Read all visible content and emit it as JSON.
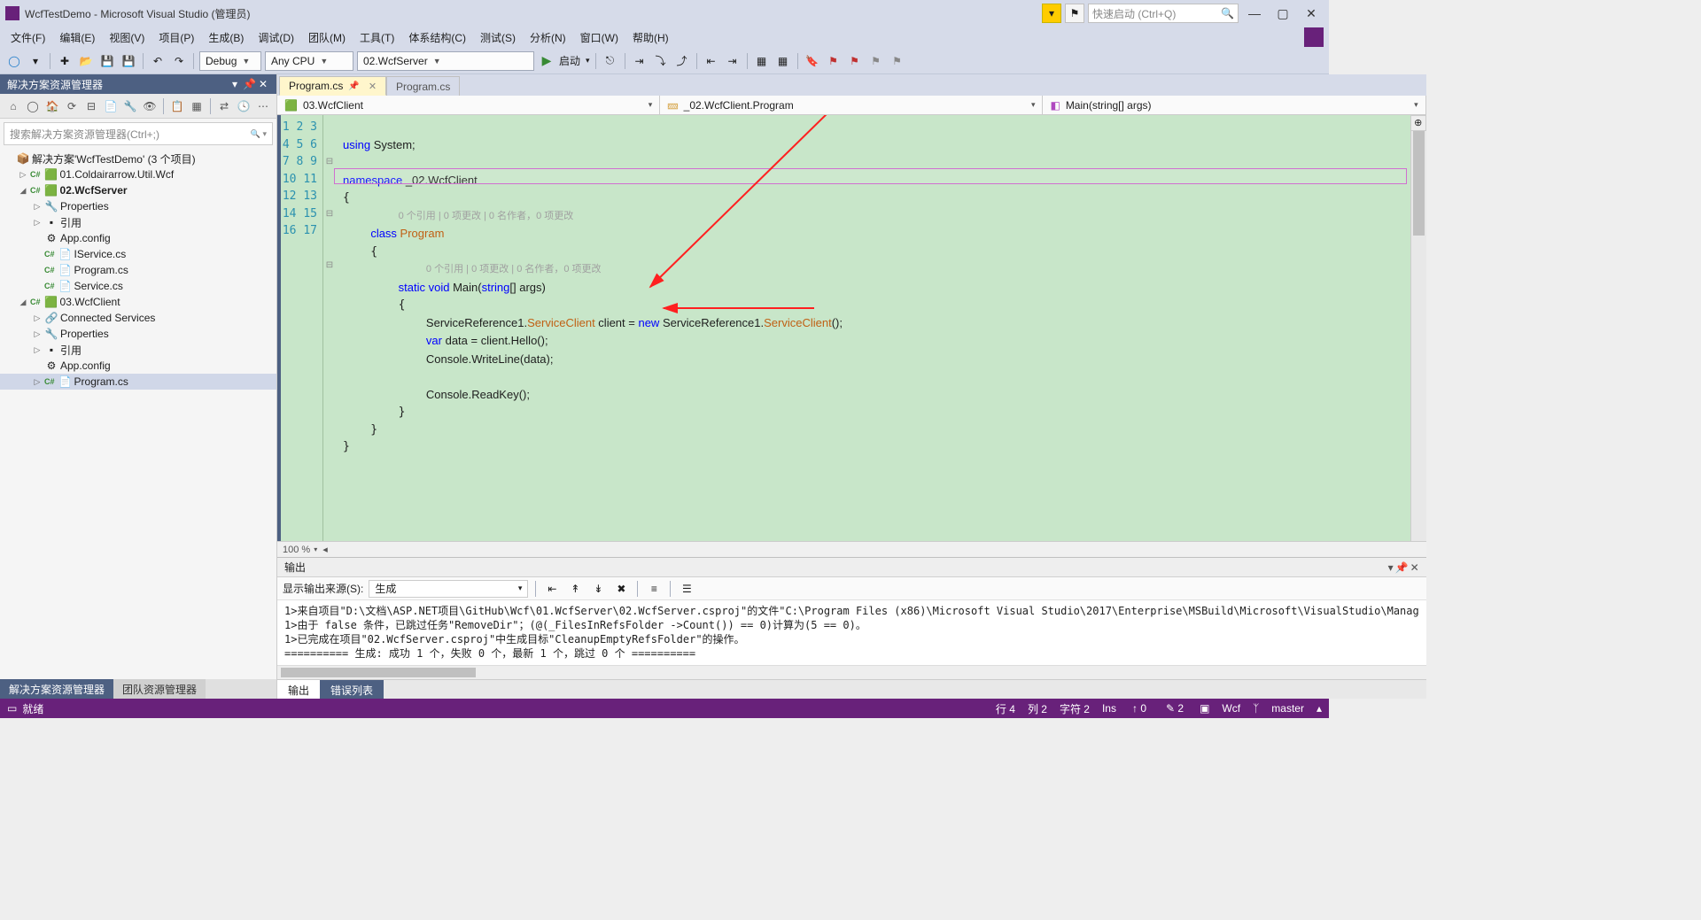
{
  "title": "WcfTestDemo - Microsoft Visual Studio (管理员)",
  "quick_launch_placeholder": "快速启动 (Ctrl+Q)",
  "menus": [
    "文件(F)",
    "编辑(E)",
    "视图(V)",
    "项目(P)",
    "生成(B)",
    "调试(D)",
    "团队(M)",
    "工具(T)",
    "体系结构(C)",
    "测试(S)",
    "分析(N)",
    "窗口(W)",
    "帮助(H)"
  ],
  "toolbar": {
    "config": "Debug",
    "platform": "Any CPU",
    "startup": "02.WcfServer",
    "start_label": "启动"
  },
  "solex": {
    "title": "解决方案资源管理器",
    "search_placeholder": "搜索解决方案资源管理器(Ctrl+;)",
    "tree": [
      {
        "d": 1,
        "exp": "",
        "ico": "📦",
        "lbl": "解决方案'WcfTestDemo' (3 个项目)",
        "bold": false
      },
      {
        "d": 2,
        "exp": "▷",
        "ico": "🟩",
        "lbl": "01.Coldairarrow.Util.Wcf",
        "csharp": true
      },
      {
        "d": 2,
        "exp": "◢",
        "ico": "🟩",
        "lbl": "02.WcfServer",
        "csharp": true,
        "bold": true
      },
      {
        "d": 3,
        "exp": "▷",
        "ico": "🔧",
        "lbl": "Properties"
      },
      {
        "d": 3,
        "exp": "▷",
        "ico": "▪",
        "lbl": "引用"
      },
      {
        "d": 3,
        "exp": "",
        "ico": "⚙",
        "lbl": "App.config"
      },
      {
        "d": 3,
        "exp": "",
        "ico": "📄",
        "lbl": "IService.cs",
        "csharp": true
      },
      {
        "d": 3,
        "exp": "",
        "ico": "📄",
        "lbl": "Program.cs",
        "csharp": true
      },
      {
        "d": 3,
        "exp": "",
        "ico": "📄",
        "lbl": "Service.cs",
        "csharp": true
      },
      {
        "d": 2,
        "exp": "◢",
        "ico": "🟩",
        "lbl": "03.WcfClient",
        "csharp": true
      },
      {
        "d": 3,
        "exp": "▷",
        "ico": "🔗",
        "lbl": "Connected Services"
      },
      {
        "d": 3,
        "exp": "▷",
        "ico": "🔧",
        "lbl": "Properties"
      },
      {
        "d": 3,
        "exp": "▷",
        "ico": "▪",
        "lbl": "引用"
      },
      {
        "d": 3,
        "exp": "",
        "ico": "⚙",
        "lbl": "App.config"
      },
      {
        "d": 3,
        "exp": "▷",
        "ico": "📄",
        "lbl": "Program.cs",
        "csharp": true,
        "sel": true
      }
    ],
    "bottom_tabs": [
      "解决方案资源管理器",
      "团队资源管理器"
    ]
  },
  "editor": {
    "tabs": [
      {
        "label": "Program.cs",
        "active": true,
        "pinned": true
      },
      {
        "label": "Program.cs",
        "active": false,
        "pinned": false
      }
    ],
    "crumbs": [
      "03.WcfClient",
      "_02.WcfClient.Program",
      "Main(string[] args)"
    ],
    "line_count": 17,
    "hints": {
      "class": "0 个引用 | 0 项更改 | 0 名作者，0 项更改",
      "method": "0 个引用 | 0 项更改 | 0 名作者，0 项更改"
    },
    "code": {
      "l1": {
        "kw": "using",
        "rest": " System;"
      },
      "l3": {
        "kw": "namespace",
        "rest": " _02.WcfClient"
      },
      "l5": {
        "kw1": "class ",
        "cls": "Program"
      },
      "l7": {
        "kw1": "static ",
        "kw2": "void",
        "rest1": " Main(",
        "kw3": "string",
        "rest2": "[] args)"
      },
      "l9": {
        "p1": "ServiceReference1.",
        "o1": "ServiceClient",
        "p2": " client = ",
        "kw": "new",
        "p3": " ServiceReference1.",
        "o2": "ServiceClient",
        "p4": "();"
      },
      "l10": {
        "kw": "var",
        "rest": " data = client.Hello();"
      },
      "l11": "Console.WriteLine(data);",
      "l13": "Console.ReadKey();"
    },
    "zoom": "100 %"
  },
  "output": {
    "title": "输出",
    "src_label": "显示输出来源(S):",
    "src_value": "生成",
    "lines": [
      "1>来自项目\"D:\\文档\\ASP.NET项目\\GitHub\\Wcf\\01.WcfServer\\02.WcfServer.csproj\"的文件\"C:\\Program Files (x86)\\Microsoft Visual Studio\\2017\\Enterprise\\MSBuild\\Microsoft\\VisualStudio\\Manag",
      "1>由于 false 条件，已跳过任务\"RemoveDir\"；(@(_FilesInRefsFolder ->Count()) == 0)计算为(5 == 0)。",
      "1>已完成在项目\"02.WcfServer.csproj\"中生成目标\"CleanupEmptyRefsFolder\"的操作。",
      "========== 生成: 成功 1 个，失败 0 个，最新 1 个，跳过 0 个 =========="
    ],
    "tabs": [
      "输出",
      "错误列表"
    ]
  },
  "status": {
    "ready": "就绪",
    "line": "行 4",
    "col": "列 2",
    "ch": "字符 2",
    "ins": "Ins",
    "publish": "↑ 0",
    "changes": "✎ 2",
    "repo": "Wcf",
    "branch": "master"
  }
}
